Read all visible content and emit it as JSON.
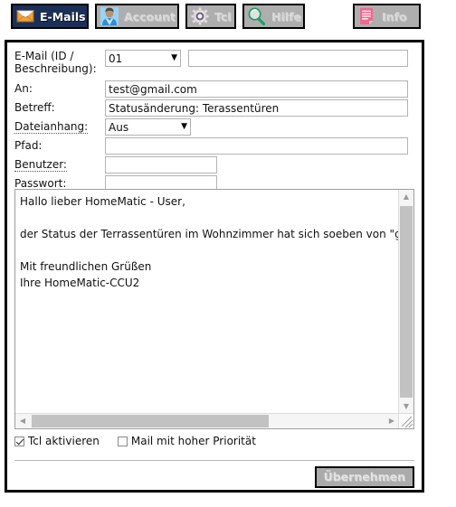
{
  "tabs": [
    {
      "label": "E-Mails",
      "icon": "envelope-icon",
      "active": true
    },
    {
      "label": "Account",
      "icon": "user-icon",
      "active": false
    },
    {
      "label": "Tcl",
      "icon": "gear-icon",
      "active": false
    },
    {
      "label": "Hilfe",
      "icon": "magnifier-icon",
      "active": false
    },
    {
      "label": "Info",
      "icon": "document-icon",
      "active": false
    }
  ],
  "form": {
    "email_id": {
      "label_line1": "E-Mail (ID /",
      "label_line2": "Beschreibung):",
      "select_value": "01",
      "description_value": "",
      "description_placeholder": ""
    },
    "an": {
      "label": "An:",
      "value": "test@gmail.com"
    },
    "betreff": {
      "label": "Betreff:",
      "value": "Statusänderung: Terassentüren"
    },
    "dateianhang": {
      "label": "Dateianhang:",
      "value": "Aus"
    },
    "pfad": {
      "label": "Pfad:",
      "value": ""
    },
    "benutzer": {
      "label": "Benutzer:",
      "value": ""
    },
    "passwort": {
      "label": "Passwort:",
      "value": ""
    }
  },
  "body": {
    "text": "Hallo lieber HomeMatic - User,\n\nder Status der Terrassentüren im Wohnzimmer hat sich soeben von \"g\n\nMit freundlichen Grüßen\nIhre HomeMatic-CCU2"
  },
  "scrollbars": {
    "up_arrow": "▲",
    "down_arrow": "▼",
    "left_arrow": "◀",
    "right_arrow": "▶"
  },
  "checkboxes": [
    {
      "label": "Tcl aktivieren",
      "checked": true
    },
    {
      "label": "Mail mit hoher Priorität",
      "checked": false
    }
  ],
  "apply": {
    "label": "Übernehmen"
  },
  "dropdown_arrow": "▼",
  "colors": {
    "active_tab_bg": "#1b3058",
    "tab_bg": "#aeaeae",
    "button_bg": "#ababab",
    "scroll_thumb": "#c2c2c2",
    "field_border": "#b3b3b3"
  }
}
